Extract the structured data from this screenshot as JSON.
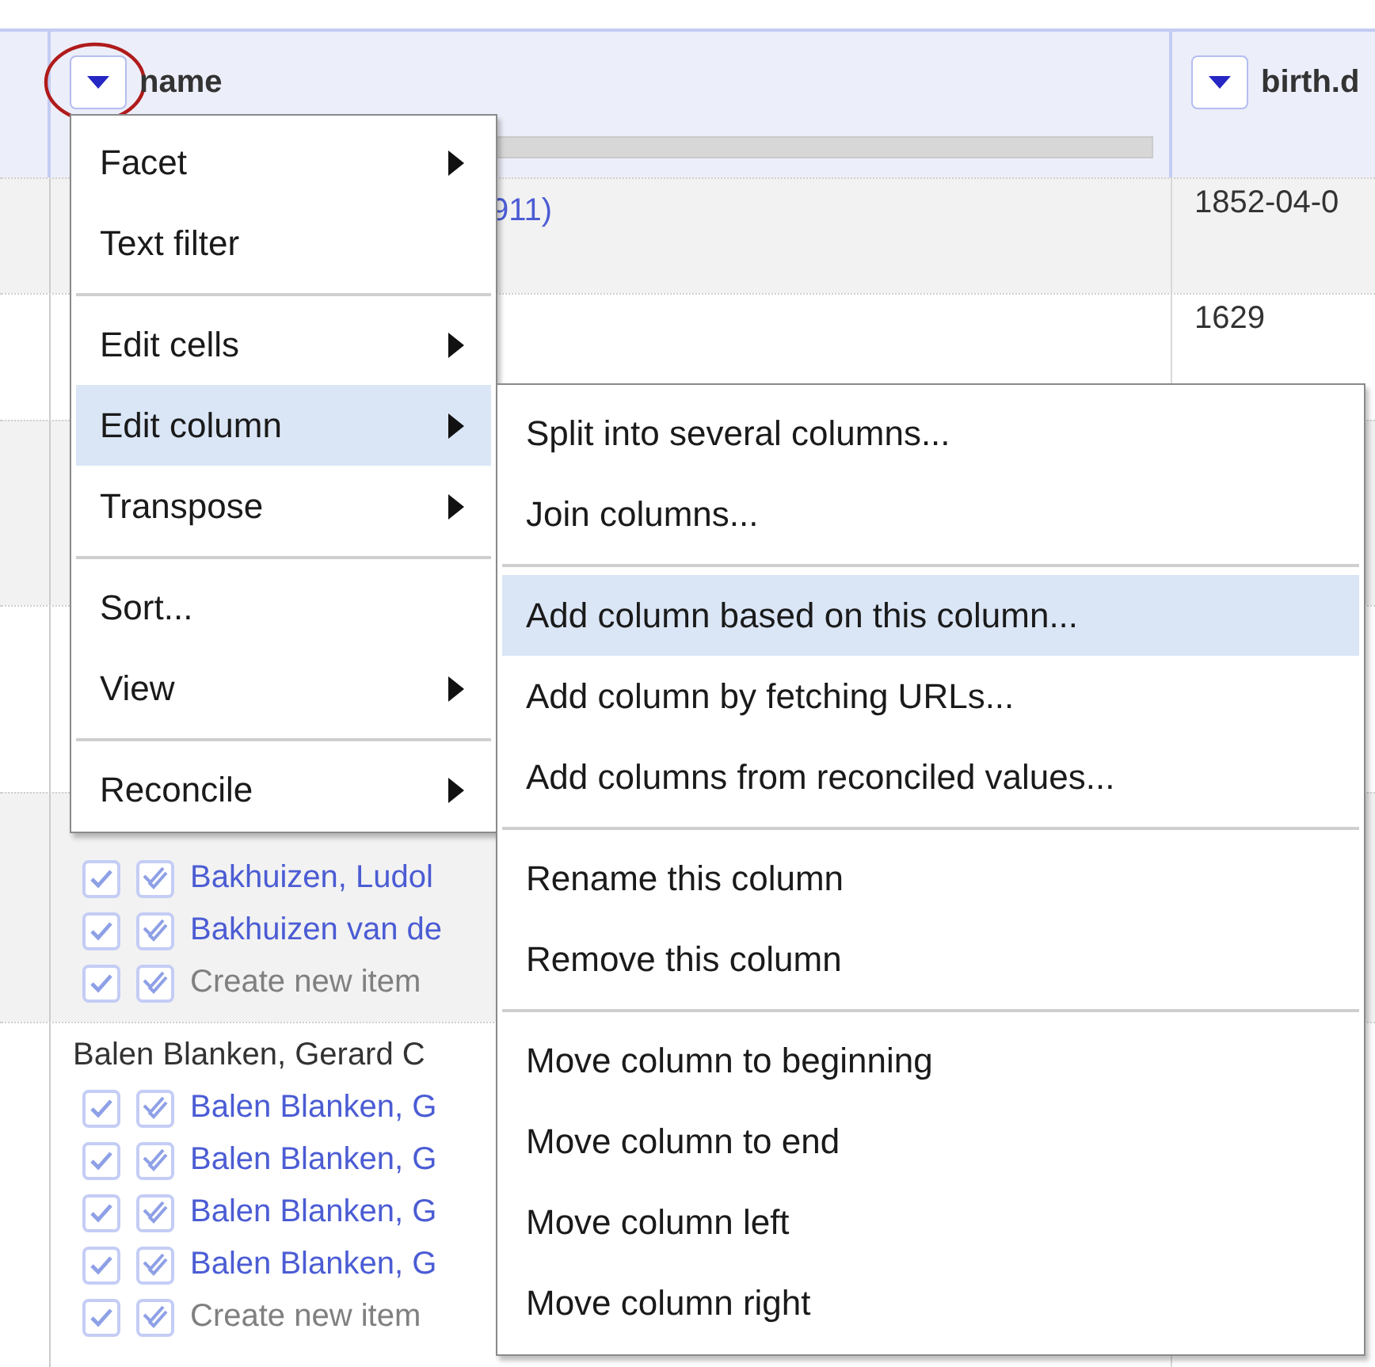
{
  "table": {
    "columns": [
      {
        "label": "name",
        "circled": true
      },
      {
        "label": "birth.d",
        "circled": false
      }
    ],
    "rows": [
      {
        "name_lines": [
          {
            "kind": "link-tail",
            "text": "911)"
          }
        ],
        "birth": "1852-04-0"
      },
      {
        "name_lines": [],
        "birth": "1629"
      },
      {
        "name_lines": []
      },
      {
        "name_lines": []
      },
      {
        "name_lines": [
          {
            "kind": "hidden"
          },
          {
            "kind": "candidate",
            "text": "Bakhuizen, Ludol"
          },
          {
            "kind": "candidate",
            "text": "Bakhuizen van de"
          },
          {
            "kind": "create",
            "text": "Create new item"
          }
        ]
      },
      {
        "name_lines": [
          {
            "kind": "text",
            "text": "Balen Blanken, Gerard C"
          },
          {
            "kind": "candidate",
            "text": "Balen Blanken, G"
          },
          {
            "kind": "candidate",
            "text": "Balen Blanken, G"
          },
          {
            "kind": "candidate",
            "text": "Balen Blanken, G"
          },
          {
            "kind": "candidate",
            "text": "Balen Blanken, G"
          },
          {
            "kind": "create",
            "text": "Create new item"
          }
        ]
      }
    ]
  },
  "column_menu": {
    "items": [
      {
        "kind": "item",
        "label": "Facet",
        "submenu": true,
        "selected": false
      },
      {
        "kind": "item",
        "label": "Text filter",
        "submenu": false,
        "selected": false
      },
      {
        "kind": "separator"
      },
      {
        "kind": "item",
        "label": "Edit cells",
        "submenu": true,
        "selected": false
      },
      {
        "kind": "item",
        "label": "Edit column",
        "submenu": true,
        "selected": true
      },
      {
        "kind": "item",
        "label": "Transpose",
        "submenu": true,
        "selected": false
      },
      {
        "kind": "separator"
      },
      {
        "kind": "item",
        "label": "Sort...",
        "submenu": false,
        "selected": false
      },
      {
        "kind": "item",
        "label": "View",
        "submenu": true,
        "selected": false
      },
      {
        "kind": "separator"
      },
      {
        "kind": "item",
        "label": "Reconcile",
        "submenu": true,
        "selected": false
      }
    ]
  },
  "edit_column_submenu": {
    "items": [
      {
        "kind": "item",
        "label": "Split into several columns...",
        "selected": false
      },
      {
        "kind": "item",
        "label": "Join columns...",
        "selected": false
      },
      {
        "kind": "separator"
      },
      {
        "kind": "item",
        "label": "Add column based on this column...",
        "selected": true
      },
      {
        "kind": "item",
        "label": "Add column by fetching URLs...",
        "selected": false
      },
      {
        "kind": "item",
        "label": "Add columns from reconciled values...",
        "selected": false
      },
      {
        "kind": "separator"
      },
      {
        "kind": "item",
        "label": "Rename this column",
        "selected": false
      },
      {
        "kind": "item",
        "label": "Remove this column",
        "selected": false
      },
      {
        "kind": "separator"
      },
      {
        "kind": "item",
        "label": "Move column to beginning",
        "selected": false
      },
      {
        "kind": "item",
        "label": "Move column to end",
        "selected": false
      },
      {
        "kind": "item",
        "label": "Move column left",
        "selected": false
      },
      {
        "kind": "item",
        "label": "Move column right",
        "selected": false
      }
    ]
  }
}
